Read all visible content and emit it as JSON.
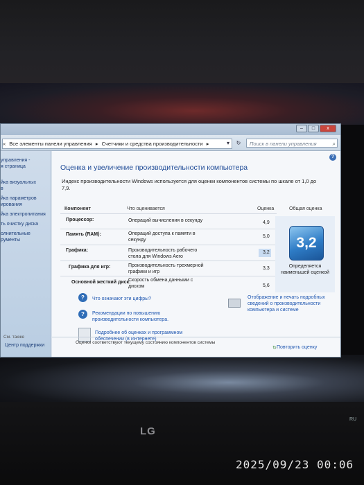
{
  "window": {
    "breadcrumb": [
      "«",
      "Все элементы панели управления",
      "▸",
      "Счетчики и средства производительности",
      "▸"
    ],
    "search_placeholder": "Поиск в панели управления",
    "controls": {
      "minimize": "–",
      "maximize": "□",
      "close": "x"
    }
  },
  "sidebar": {
    "items": [
      "управления -",
      "я страница",
      "йка визуальных",
      "в",
      "йка параметров",
      "ирования",
      "йка электропитания",
      "ть очистку диска",
      "олнительные",
      "рументы"
    ],
    "see_also": "См. также",
    "support": "Центр поддержки"
  },
  "main": {
    "title": "Оценка и увеличение производительности компьютера",
    "description": "Индекс производительности Windows используется для оценки компонентов системы по шкале от 1,0 до 7,9.",
    "columns": {
      "component": "Компонент",
      "what": "Что оценивается",
      "score": "Оценка",
      "total": "Общая оценка"
    },
    "rows": [
      {
        "component": "Процессор:",
        "what": "Операций вычисления в секунду",
        "score": "4,9"
      },
      {
        "component": "Память (RAM):",
        "what": "Операций доступа к памяти в секунду",
        "score": "5,0"
      },
      {
        "component": "Графика:",
        "what": "Производительность рабочего стола для Windows Aero",
        "score": "3,2"
      },
      {
        "component": "Графика для игр:",
        "what": "Производительность трехмерной графики и игр",
        "score": "3,3"
      },
      {
        "component": "Основной жесткий диск:",
        "what": "Скорость обмена данными с диском",
        "score": "5,6"
      }
    ],
    "total_score": "3,2",
    "total_note": "Определяется наименьшей оценкой",
    "links": {
      "what_mean": "Что означают эти цифры?",
      "tips": "Рекомендации по повышению производительности компьютера.",
      "print": "Отображение и печать подробных сведений о производительности компьютера и системе",
      "online": "Подробнее об оценках и программном обеспечении (в Интернете)"
    },
    "footer": "Оценки соответствуют текущему состоянию компонентов системы",
    "rerun": "Повторить оценку"
  },
  "monitor": {
    "brand": "LG",
    "lang": "RU"
  },
  "photo": {
    "timestamp": "2025/09/23  00:06"
  },
  "colors": {
    "accent": "#1e4a96",
    "badge": "#2e7cc6"
  }
}
